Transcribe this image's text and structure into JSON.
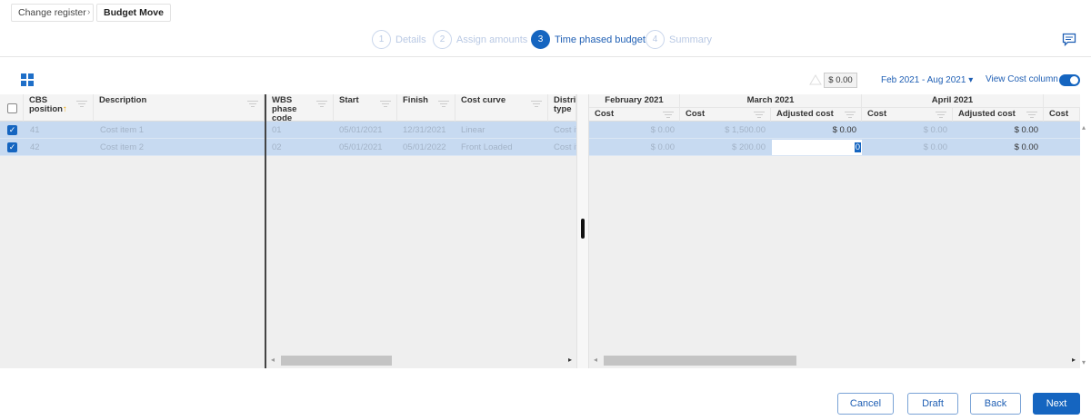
{
  "breadcrumb": {
    "parent": "Change register",
    "current": "Budget Move"
  },
  "steps": [
    {
      "num": "1",
      "label": "Details"
    },
    {
      "num": "2",
      "label": "Assign amounts"
    },
    {
      "num": "3",
      "label": "Time phased budget"
    },
    {
      "num": "4",
      "label": "Summary"
    }
  ],
  "toolbar": {
    "total": "$ 0.00",
    "date_range": "Feb 2021 - Aug 2021",
    "view_cost_label": "View Cost column",
    "view_cost_on": true
  },
  "left_columns": {
    "cbs": "CBS position",
    "description": "Description"
  },
  "mid_columns": {
    "wbs": "WBS phase code",
    "start": "Start",
    "finish": "Finish",
    "cost_curve": "Cost curve",
    "distri": "Distri type"
  },
  "months": {
    "feb": "February 2021",
    "mar": "March 2021",
    "apr": "April 2021"
  },
  "sub_columns": {
    "cost": "Cost",
    "adjusted": "Adjusted cost"
  },
  "rows": [
    {
      "cbs": "41",
      "description": "Cost item 1",
      "wbs": "01",
      "start": "05/01/2021",
      "finish": "12/31/2021",
      "curve": "Linear",
      "distri": "Cost it",
      "feb_cost": "$ 0.00",
      "mar_cost": "$ 1,500.00",
      "mar_adj": "$ 0.00",
      "apr_cost": "$ 0.00",
      "apr_adj": "$ 0.00"
    },
    {
      "cbs": "42",
      "description": "Cost item 2",
      "wbs": "02",
      "start": "05/01/2021",
      "finish": "05/01/2022",
      "curve": "Front Loaded",
      "distri": "Cost it",
      "feb_cost": "$ 0.00",
      "mar_cost": "$ 200.00",
      "mar_adj": "0",
      "apr_cost": "$ 0.00",
      "apr_adj": "$ 0.00"
    }
  ],
  "footer": {
    "cancel": "Cancel",
    "draft": "Draft",
    "back": "Back",
    "next": "Next"
  }
}
